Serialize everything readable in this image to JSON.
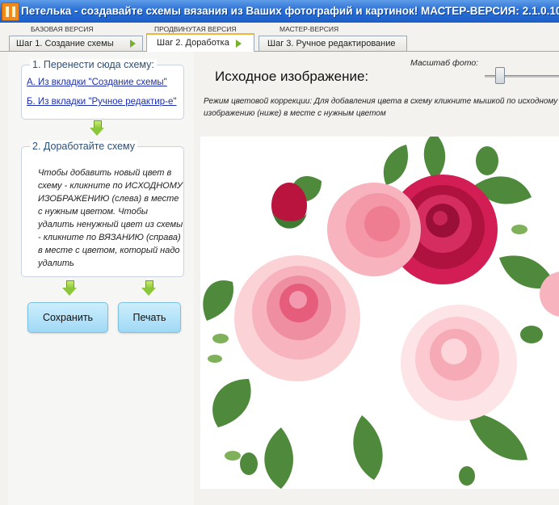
{
  "window": {
    "title": "Петелька - создавайте схемы вязания из Ваших фотографий и картинок! МАСТЕР-ВЕРСИЯ: 2.1.0.10"
  },
  "versions": {
    "basic": "БАЗОВАЯ ВЕРСИЯ",
    "advanced": "ПРОДВИНУТАЯ ВЕРСИЯ",
    "master": "МАСТЕР-ВЕРСИЯ"
  },
  "tabs": [
    {
      "label": "Шаг 1. Создание схемы"
    },
    {
      "label": "Шаг 2. Доработка"
    },
    {
      "label": "Шаг 3. Ручное редактирование"
    }
  ],
  "left": {
    "group1_title": "1. Перенести сюда схему:",
    "link_a": "А. Из вкладки \"Создание схемы\"",
    "link_b": "Б. Из вкладки \"Ручное редактир-е\"",
    "group2_title": "2. Доработайте схему",
    "instructions": "Чтобы добавить новый цвет в схему - кликните по ИСХОДНОМУ ИЗОБРАЖЕНИЮ (слева) в месте с нужным цветом. Чтобы удалить ненужный цвет из схемы - кликните по ВЯЗАНИЮ (справа) в месте с цветом, который надо удалить",
    "save_label": "Сохранить",
    "print_label": "Печать"
  },
  "main": {
    "scale_label": "Масштаб фото:",
    "scale_fraction": 0.18,
    "heading": "Исходное изображение:",
    "hint_line1": "Режим цветовой коррекции: Для добавления цвета в схему кликните мышкой по исходному",
    "hint_line2": "изображению (ниже) в месте с нужным цветом"
  },
  "colors": {
    "title_bar": "#2a6fd6",
    "link": "#1b2fb0",
    "button": "#9fd9f5",
    "rose_dark": "#b8143d",
    "rose_pink": "#f29aa7",
    "leaf": "#4f8a3c"
  }
}
